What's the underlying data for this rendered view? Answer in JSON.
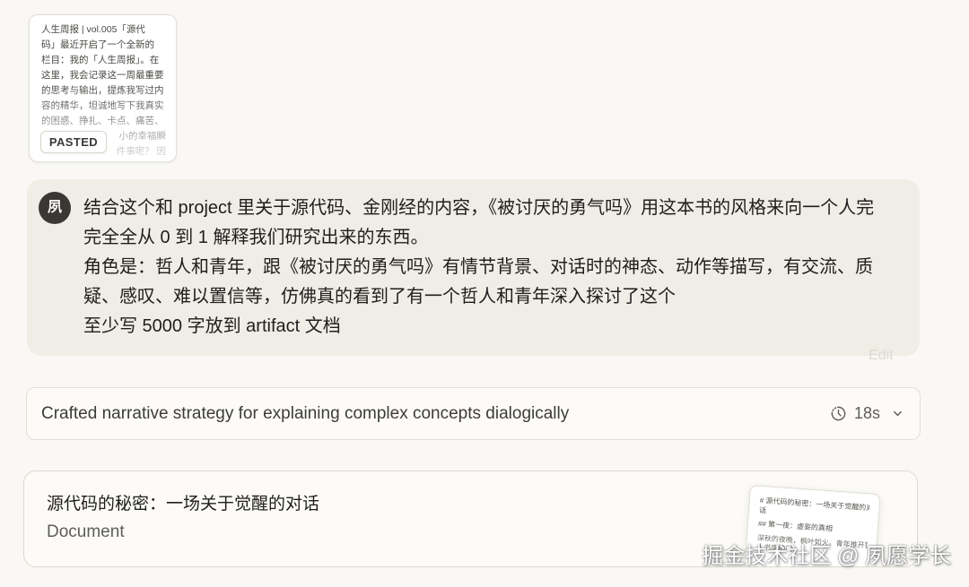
{
  "pasted_attachment": {
    "lines": [
      "人生周报 | vol.005「源代",
      "码」最近开启了一个全新的",
      "栏目：我的「人生周报」。在",
      "这里，我会记录这一周最重要",
      "的思考与输出，提炼我写过内",
      "容的精华，坦诚地写下我真实",
      "的困惑、挣扎、卡点、痛苦、"
    ],
    "partially_hidden_lines": [
      "小的幸福瞬",
      "件事呢？ 因"
    ],
    "badge_label": "PASTED"
  },
  "user_message": {
    "avatar_initial": "夙",
    "lines": [
      "结合这个和 project 里关于源代码、金刚经的内容，《被讨厌的勇气吗》用这本书的风格来向一个人完",
      "完全全从 0 到 1 解释我们研究出来的东西。",
      "角色是：哲人和青年，跟《被讨厌的勇气吗》有情节背景、对话时的神态、动作等描写，有交流、质",
      "疑、感叹、难以置信等，仿佛真的看到了有一个哲人和青年深入探讨了这个",
      "至少写 5000 字放到 artifact 文档"
    ],
    "edit_label": "Edit"
  },
  "thinking": {
    "summary": "Crafted narrative strategy for explaining complex concepts dialogically",
    "duration": "18s",
    "status_icon": "clock-dashed-icon",
    "toggle_icon": "chevron-down-icon"
  },
  "artifact": {
    "title": "源代码的秘密：一场关于觉醒的对话",
    "type_label": "Document",
    "preview_lines": [
      "# 源代码的秘密：一场关于觉醒的对",
      "话",
      "## 第一夜：虚妄的真相",
      "深秋的夜晚，枫叶如火。青年推开哲",
      "人书房的门，"
    ]
  },
  "watermark": "掘金技术社区 @ 夙愿学长",
  "theme": {
    "page_bg": "#f9f8f4",
    "bubble_bg": "#efede6",
    "card_bg": "#fcfbf8",
    "border": "#e2dfd6",
    "avatar_bg": "#3a3834",
    "text_primary": "#1f1e1c",
    "text_secondary": "#5e5d58"
  }
}
